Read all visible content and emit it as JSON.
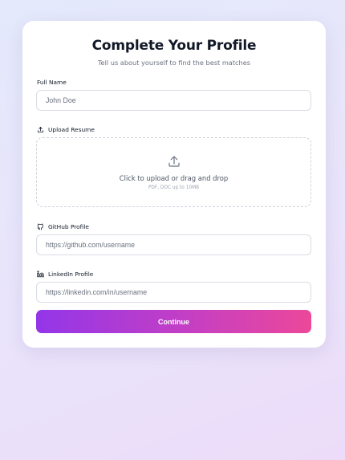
{
  "header": {
    "title": "Complete Your Profile",
    "subtitle": "Tell us about yourself to find the best matches"
  },
  "form": {
    "full_name": {
      "label": "Full Name",
      "placeholder": "John Doe",
      "value": ""
    },
    "resume": {
      "label": "Upload Resume",
      "icon": "upload-icon",
      "dropzone_text": "Click to upload or drag and drop",
      "dropzone_hint": "PDF, DOC up to 10MB"
    },
    "github": {
      "label": "GitHub Profile",
      "icon": "github-icon",
      "placeholder": "https://github.com/username",
      "value": ""
    },
    "linkedin": {
      "label": "LinkedIn Profile",
      "icon": "linkedin-icon",
      "placeholder": "https://linkedin.com/in/username",
      "value": ""
    },
    "submit_label": "Continue"
  },
  "colors": {
    "accent_start": "#9336e8",
    "accent_end": "#ec4899",
    "title": "#111827",
    "muted": "#6b7280"
  }
}
